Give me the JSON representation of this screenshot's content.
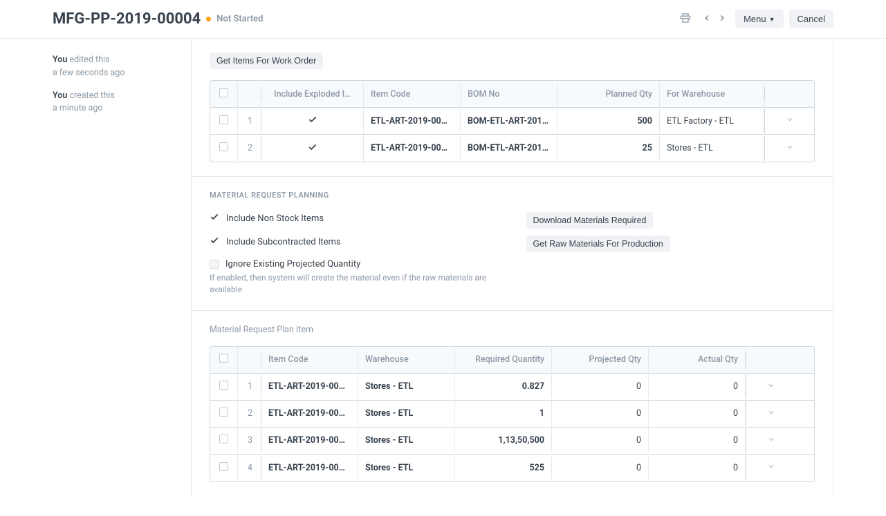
{
  "header": {
    "title": "MFG-PP-2019-00004",
    "status": "Not Started",
    "menu_label": "Menu",
    "cancel_label": "Cancel"
  },
  "timeline": [
    {
      "who": "You",
      "action": "edited this",
      "when": "a few seconds ago"
    },
    {
      "who": "You",
      "action": "created this",
      "when": "a minute ago"
    }
  ],
  "work_order_section": {
    "get_items_label": "Get Items For Work Order",
    "columns": {
      "include_exploded": "Include Exploded I…",
      "item_code": "Item Code",
      "bom_no": "BOM No",
      "planned_qty": "Planned Qty",
      "for_warehouse": "For Warehouse"
    },
    "rows": [
      {
        "idx": "1",
        "include_exploded": true,
        "item_code": "ETL-ART-2019-00…",
        "bom_no": "BOM-ETL-ART-201…",
        "planned_qty": "500",
        "for_warehouse": "ETL Factory - ETL"
      },
      {
        "idx": "2",
        "include_exploded": true,
        "item_code": "ETL-ART-2019-00…",
        "bom_no": "BOM-ETL-ART-201…",
        "planned_qty": "25",
        "for_warehouse": "Stores - ETL"
      }
    ]
  },
  "mrp_section": {
    "title": "MATERIAL REQUEST PLANNING",
    "include_non_stock": "Include Non Stock Items",
    "include_subcontracted": "Include Subcontracted Items",
    "ignore_projected": "Ignore Existing Projected Quantity",
    "ignore_help": "If enabled, then system will create the material even if the raw materials are available",
    "download_label": "Download Materials Required",
    "get_raw_label": "Get Raw Materials For Production"
  },
  "mr_plan": {
    "heading": "Material Request Plan Item",
    "columns": {
      "item_code": "Item Code",
      "warehouse": "Warehouse",
      "required_qty": "Required Quantity",
      "projected_qty": "Projected Qty",
      "actual_qty": "Actual Qty"
    },
    "rows": [
      {
        "idx": "1",
        "item_code": "ETL-ART-2019-00…",
        "warehouse": "Stores - ETL",
        "required_qty": "0.827",
        "projected_qty": "0",
        "actual_qty": "0"
      },
      {
        "idx": "2",
        "item_code": "ETL-ART-2019-00…",
        "warehouse": "Stores - ETL",
        "required_qty": "1",
        "projected_qty": "0",
        "actual_qty": "0"
      },
      {
        "idx": "3",
        "item_code": "ETL-ART-2019-00…",
        "warehouse": "Stores - ETL",
        "required_qty": "1,13,50,500",
        "projected_qty": "0",
        "actual_qty": "0"
      },
      {
        "idx": "4",
        "item_code": "ETL-ART-2019-00…",
        "warehouse": "Stores - ETL",
        "required_qty": "525",
        "projected_qty": "0",
        "actual_qty": "0"
      }
    ]
  }
}
